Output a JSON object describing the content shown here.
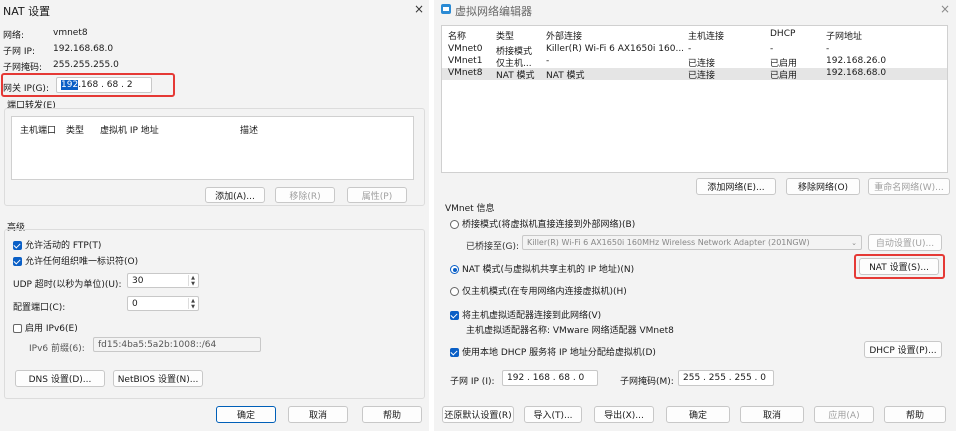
{
  "left": {
    "title": "NAT 设置",
    "close": "×",
    "network_label": "网络:",
    "network_value": "vmnet8",
    "subnet_ip_label": "子网 IP:",
    "subnet_ip_value": "192.168.68.0",
    "subnet_mask_label": "子网掩码:",
    "subnet_mask_value": "255.255.255.0",
    "gateway_label": "网关 IP(G):",
    "gateway_selected": "192",
    "gateway_rest": ".168 . 68 . 2",
    "port_forward_title": "端口转发(E)",
    "columns": [
      "主机端口",
      "类型",
      "虚拟机 IP 地址",
      "描述"
    ],
    "add_btn": "添加(A)...",
    "remove_btn": "移除(R)",
    "props_btn": "属性(P)",
    "advanced_title": "高级",
    "allow_ftp": "允许活动的 FTP(T)",
    "allow_oui": "允许任何组织唯一标识符(O)",
    "udp_timeout_label": "UDP 超时(以秒为单位)(U):",
    "udp_timeout_value": "30",
    "config_port_label": "配置端口(C):",
    "config_port_value": "0",
    "enable_ipv6": "启用 IPv6(E)",
    "ipv6_prefix_label": "IPv6 前缀(6):",
    "ipv6_prefix_value": "fd15:4ba5:5a2b:1008::/64",
    "dns_btn": "DNS 设置(D)...",
    "netbios_btn": "NetBIOS 设置(N)...",
    "ok_btn": "确定",
    "cancel_btn": "取消",
    "help_btn": "帮助"
  },
  "right": {
    "title": "虚拟网络编辑器",
    "close": "×",
    "columns": [
      "名称",
      "类型",
      "外部连接",
      "主机连接",
      "DHCP",
      "子网地址"
    ],
    "rows": [
      [
        "VMnet0",
        "桥接模式",
        "Killer(R) Wi-Fi 6 AX1650i 160...",
        "-",
        "-",
        "-"
      ],
      [
        "VMnet1",
        "仅主机...",
        "-",
        "已连接",
        "已启用",
        "192.168.26.0"
      ],
      [
        "VMnet8",
        "NAT 模式",
        "NAT 模式",
        "已连接",
        "已启用",
        "192.168.68.0"
      ]
    ],
    "add_network_btn": "添加网络(E)...",
    "remove_network_btn": "移除网络(O)",
    "rename_network_btn": "重命名网络(W)...",
    "vmnet_info": "VMnet 信息",
    "bridge_mode": "桥接模式(将虚拟机直接连接到外部网络)(B)",
    "bridged_to_label": "已桥接至(G):",
    "bridged_to_value": "Killer(R) Wi-Fi 6 AX1650i 160MHz Wireless Network Adapter (201NGW)",
    "auto_settings_btn": "自动设置(U)...",
    "nat_mode": "NAT 模式(与虚拟机共享主机的 IP 地址)(N)",
    "nat_settings_btn": "NAT 设置(S)...",
    "host_only_mode": "仅主机模式(在专用网络内连接虚拟机)(H)",
    "connect_adapter": "将主机虚拟适配器连接到此网络(V)",
    "adapter_name": "主机虚拟适配器名称: VMware 网络适配器 VMnet8",
    "use_dhcp": "使用本地 DHCP 服务将 IP 地址分配给虚拟机(D)",
    "dhcp_settings_btn": "DHCP 设置(P)...",
    "subnet_ip_label": "子网 IP (I):",
    "subnet_ip_value": "192 . 168 . 68 . 0",
    "subnet_mask_label": "子网掩码(M):",
    "subnet_mask_value": "255 . 255 . 255 . 0",
    "restore_btn": "还原默认设置(R)",
    "import_btn": "导入(T)...",
    "export_btn": "导出(X)...",
    "ok_btn": "确定",
    "cancel_btn": "取消",
    "apply_btn": "应用(A)",
    "help_btn": "帮助"
  },
  "colors": {
    "accent": "#0a5fc6",
    "highlight": "#e53935"
  }
}
